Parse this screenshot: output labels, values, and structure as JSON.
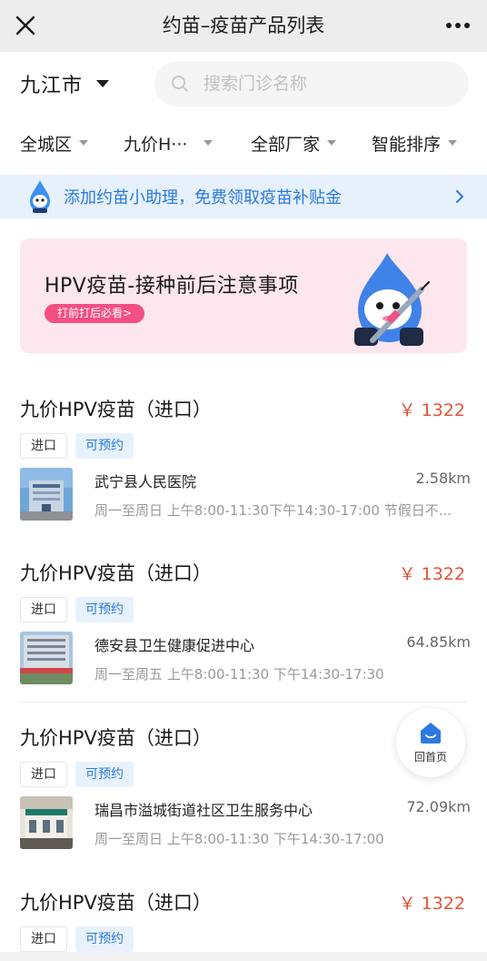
{
  "header": {
    "title": "约苗–疫苗产品列表",
    "close_icon": "close-icon",
    "more_icon": "more-icon"
  },
  "location": {
    "city": "九江市",
    "dropdown_icon": "caret-down-icon"
  },
  "search": {
    "placeholder": "搜索门诊名称",
    "value": "",
    "icon": "search-icon"
  },
  "filters": [
    {
      "label": "全城区"
    },
    {
      "label": "九价H···"
    },
    {
      "label": "全部厂家"
    },
    {
      "label": "智能排序"
    }
  ],
  "assistant_banner": {
    "text": "添加约苗小助理，免费领取疫苗补贴金",
    "icon": "mascot-icon",
    "accent_color": "#2a7ae0"
  },
  "promo": {
    "title": "HPV疫苗-接种前后注意事项",
    "badge": "打前打后必看>",
    "background_color": "#fde6ee",
    "badge_color": "#f25082"
  },
  "items": [
    {
      "vaccine": "九价HPV疫苗（进口）",
      "price": "￥ 1322",
      "tags": [
        "进口",
        "可预约"
      ],
      "clinic": "武宁县人民医院",
      "distance": "2.58km",
      "hours": "周一至周日 上午8:00-11:30下午14:30-17:00 节假日不..."
    },
    {
      "vaccine": "九价HPV疫苗（进口）",
      "price": "￥ 1322",
      "tags": [
        "进口",
        "可预约"
      ],
      "clinic": "德安县卫生健康促进中心",
      "distance": "64.85km",
      "hours": "周一至周五 上午8:00-11:30 下午14:30-17:30"
    },
    {
      "vaccine": "九价HPV疫苗（进口）",
      "price": "",
      "tags": [
        "进口",
        "可预约"
      ],
      "clinic": "瑞昌市溢城街道社区卫生服务中心",
      "distance": "72.09km",
      "hours": "周一至周日 上午8:00-11:30 下午14:30-17:00"
    },
    {
      "vaccine": "九价HPV疫苗（进口）",
      "price": "￥ 1322",
      "tags": [
        "进口",
        "可预约"
      ]
    }
  ],
  "home_button": {
    "label": "回首页",
    "icon": "home-icon"
  },
  "colors": {
    "price": "#e0553a",
    "tag_book": "#2a7ae0"
  }
}
